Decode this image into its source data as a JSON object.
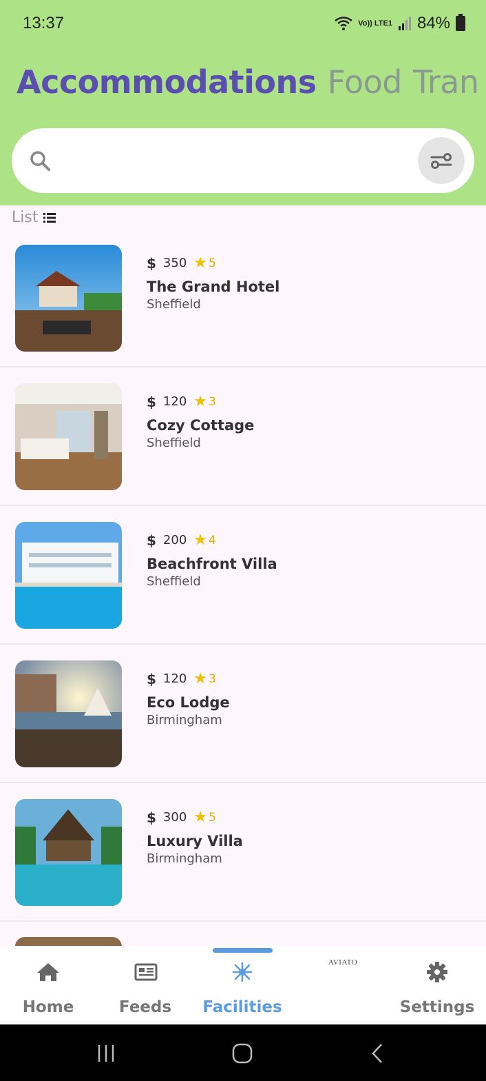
{
  "status_bar": {
    "time": "13:37",
    "lte": "Vo)) LTE1",
    "battery": "84%"
  },
  "tabs": [
    {
      "label": "Accommodations",
      "active": true
    },
    {
      "label": "Food",
      "active": false
    },
    {
      "label": "Tran",
      "active": false
    }
  ],
  "search": {
    "placeholder": ""
  },
  "list_label": "List",
  "items": [
    {
      "price": "350",
      "rating": "5",
      "name": "The Grand Hotel",
      "city": "Sheffield"
    },
    {
      "price": "120",
      "rating": "3",
      "name": "Cozy Cottage",
      "city": "Sheffield"
    },
    {
      "price": "200",
      "rating": "4",
      "name": "Beachfront Villa",
      "city": "Sheffield"
    },
    {
      "price": "120",
      "rating": "3",
      "name": "Eco Lodge",
      "city": "Birmingham"
    },
    {
      "price": "300",
      "rating": "5",
      "name": "Luxury Villa",
      "city": "Birmingham"
    }
  ],
  "nav": {
    "home": "Home",
    "feeds": "Feeds",
    "facilities": "Facilities",
    "aviato": "AVIATO",
    "settings": "Settings"
  },
  "colors": {
    "header_bg": "#aee287",
    "active_tab": "#5a4fb0",
    "nav_active": "#5b9ce0",
    "star": "#f0c000"
  }
}
